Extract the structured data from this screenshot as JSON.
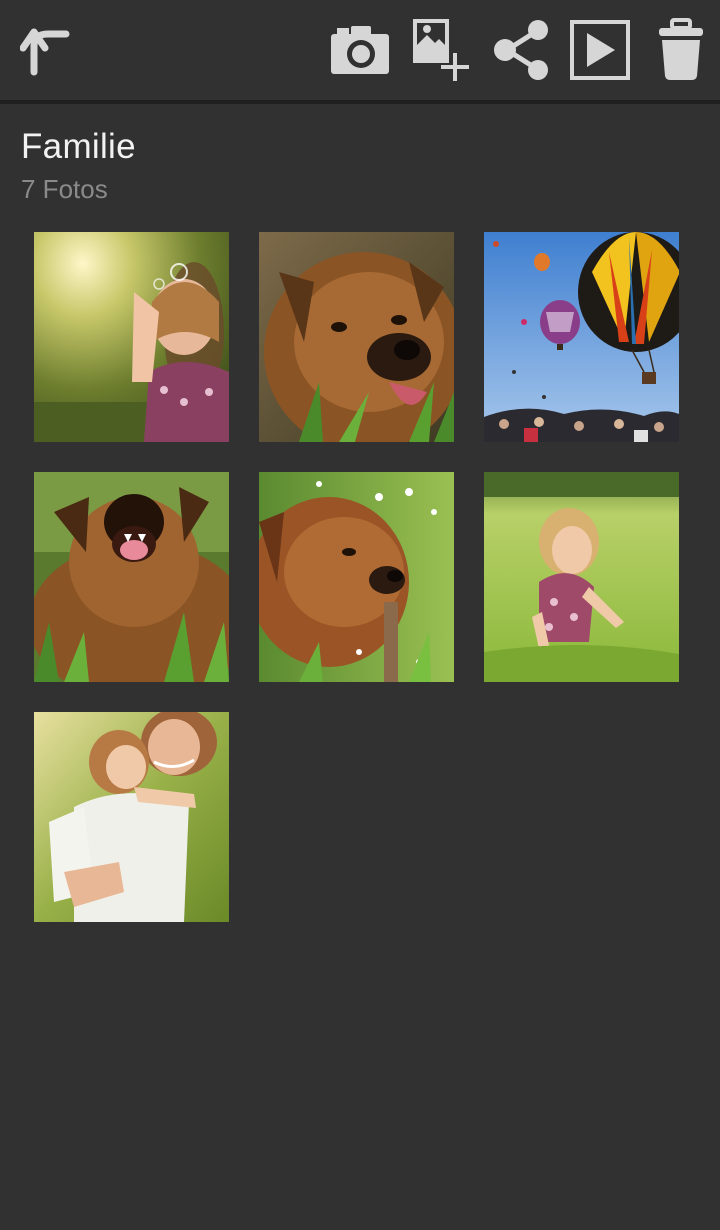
{
  "toolbar": {
    "icons": [
      "back-icon",
      "camera-icon",
      "add-photo-icon",
      "share-icon",
      "slideshow-play-icon",
      "trash-icon"
    ],
    "icon_color": "#d6d6d6"
  },
  "album": {
    "title": "Familie",
    "count_label": "7 Fotos"
  },
  "photos": [
    {
      "subject": "girl-blowing-bubbles"
    },
    {
      "subject": "dog-in-grass"
    },
    {
      "subject": "hot-air-balloons"
    },
    {
      "subject": "dog-barking"
    },
    {
      "subject": "dog-lying-in-grass"
    },
    {
      "subject": "girl-on-lawn"
    },
    {
      "subject": "mother-and-daughter"
    }
  ],
  "colors": {
    "background": "#313131",
    "title": "#f2f2f2",
    "subtitle": "#8a8a8a"
  }
}
